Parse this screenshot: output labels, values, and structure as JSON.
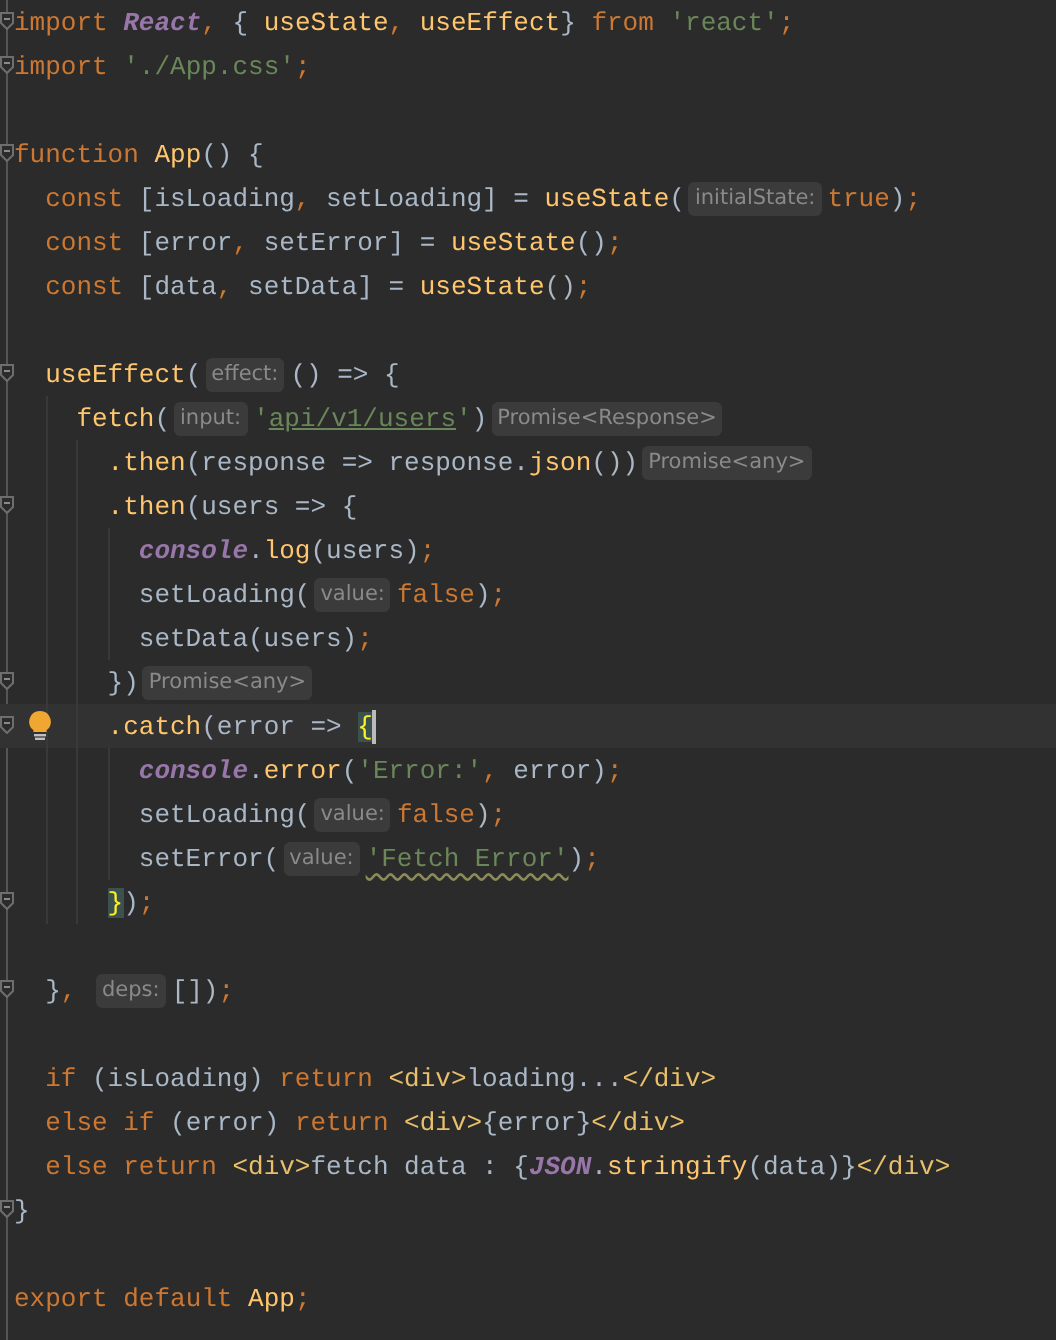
{
  "editor": {
    "lines": [
      {
        "fold": true,
        "current": false,
        "caret": false,
        "bulb": false,
        "tokens": [
          {
            "kind": "keyword",
            "text": "import "
          },
          {
            "kind": "global",
            "text": "React"
          },
          {
            "kind": "punct",
            "text": ", "
          },
          {
            "kind": "plain",
            "text": "{ "
          },
          {
            "kind": "function",
            "text": "useState"
          },
          {
            "kind": "punct",
            "text": ", "
          },
          {
            "kind": "function",
            "text": "useEffect"
          },
          {
            "kind": "plain",
            "text": "} "
          },
          {
            "kind": "keyword",
            "text": "from "
          },
          {
            "kind": "string",
            "text": "'react'"
          },
          {
            "kind": "punct",
            "text": ";"
          }
        ]
      },
      {
        "fold": true,
        "current": false,
        "caret": false,
        "bulb": false,
        "tokens": [
          {
            "kind": "keyword",
            "text": "import "
          },
          {
            "kind": "string",
            "text": "'./App.css'"
          },
          {
            "kind": "punct",
            "text": ";"
          }
        ]
      },
      {
        "fold": false,
        "current": false,
        "caret": false,
        "bulb": false
      },
      {
        "fold": true,
        "current": false,
        "caret": false,
        "bulb": false,
        "tokens": [
          {
            "kind": "keyword",
            "text": "function "
          },
          {
            "kind": "function",
            "text": "App"
          },
          {
            "kind": "plain",
            "text": "() {"
          }
        ]
      },
      {
        "fold": false,
        "current": false,
        "caret": false,
        "bulb": false,
        "tokens": [
          {
            "kind": "keyword",
            "text": "  const "
          },
          {
            "kind": "plain",
            "text": "[isLoading"
          },
          {
            "kind": "punct",
            "text": ", "
          },
          {
            "kind": "plain",
            "text": "setLoading] = "
          },
          {
            "kind": "function",
            "text": "useState"
          },
          {
            "kind": "plain",
            "text": "("
          },
          {
            "kind": "hint",
            "text": "initialState:"
          },
          {
            "kind": "keyword",
            "text": "true"
          },
          {
            "kind": "plain",
            "text": ")"
          },
          {
            "kind": "punct",
            "text": ";"
          }
        ]
      },
      {
        "fold": false,
        "current": false,
        "caret": false,
        "bulb": false,
        "tokens": [
          {
            "kind": "keyword",
            "text": "  const "
          },
          {
            "kind": "plain",
            "text": "[error"
          },
          {
            "kind": "punct",
            "text": ", "
          },
          {
            "kind": "plain",
            "text": "setError] = "
          },
          {
            "kind": "function",
            "text": "useState"
          },
          {
            "kind": "plain",
            "text": "()"
          },
          {
            "kind": "punct",
            "text": ";"
          }
        ]
      },
      {
        "fold": false,
        "current": false,
        "caret": false,
        "bulb": false,
        "tokens": [
          {
            "kind": "keyword",
            "text": "  const "
          },
          {
            "kind": "plain",
            "text": "[data"
          },
          {
            "kind": "punct",
            "text": ", "
          },
          {
            "kind": "plain",
            "text": "setData] = "
          },
          {
            "kind": "function",
            "text": "useState"
          },
          {
            "kind": "plain",
            "text": "()"
          },
          {
            "kind": "punct",
            "text": ";"
          }
        ]
      },
      {
        "fold": false,
        "current": false,
        "caret": false,
        "bulb": false
      },
      {
        "fold": true,
        "current": false,
        "caret": false,
        "bulb": false,
        "tokens": [
          {
            "kind": "function",
            "text": "  useEffect"
          },
          {
            "kind": "plain",
            "text": "("
          },
          {
            "kind": "hint",
            "text": "effect:"
          },
          {
            "kind": "plain",
            "text": "() => {"
          }
        ]
      },
      {
        "fold": false,
        "current": false,
        "caret": false,
        "bulb": false,
        "tokens": [
          {
            "kind": "function",
            "text": "    fetch"
          },
          {
            "kind": "plain",
            "text": "("
          },
          {
            "kind": "hint",
            "text": "input:"
          },
          {
            "kind": "string",
            "text": "'"
          },
          {
            "kind": "link",
            "text": "api/v1/users"
          },
          {
            "kind": "string",
            "text": "'"
          },
          {
            "kind": "plain",
            "text": ")"
          },
          {
            "kind": "hint",
            "text": "Promise<Response>"
          }
        ]
      },
      {
        "fold": false,
        "current": false,
        "caret": false,
        "bulb": false,
        "tokens": [
          {
            "kind": "function",
            "text": "      .then"
          },
          {
            "kind": "plain",
            "text": "(response => response."
          },
          {
            "kind": "function",
            "text": "json"
          },
          {
            "kind": "plain",
            "text": "())"
          },
          {
            "kind": "hint",
            "text": "Promise<any>"
          }
        ]
      },
      {
        "fold": true,
        "current": false,
        "caret": false,
        "bulb": false,
        "tokens": [
          {
            "kind": "function",
            "text": "      .then"
          },
          {
            "kind": "plain",
            "text": "(users => {"
          }
        ]
      },
      {
        "fold": false,
        "current": false,
        "caret": false,
        "bulb": false,
        "tokens": [
          {
            "kind": "global",
            "text": "        console"
          },
          {
            "kind": "plain",
            "text": "."
          },
          {
            "kind": "function",
            "text": "log"
          },
          {
            "kind": "plain",
            "text": "(users)"
          },
          {
            "kind": "punct",
            "text": ";"
          }
        ]
      },
      {
        "fold": false,
        "current": false,
        "caret": false,
        "bulb": false,
        "tokens": [
          {
            "kind": "plain",
            "text": "        setLoading("
          },
          {
            "kind": "hint",
            "text": "value:"
          },
          {
            "kind": "keyword",
            "text": "false"
          },
          {
            "kind": "plain",
            "text": ")"
          },
          {
            "kind": "punct",
            "text": ";"
          }
        ]
      },
      {
        "fold": false,
        "current": false,
        "caret": false,
        "bulb": false,
        "tokens": [
          {
            "kind": "plain",
            "text": "        setData(users)"
          },
          {
            "kind": "punct",
            "text": ";"
          }
        ]
      },
      {
        "fold": true,
        "current": false,
        "caret": false,
        "bulb": false,
        "tokens": [
          {
            "kind": "plain",
            "text": "      })"
          },
          {
            "kind": "hint",
            "text": "Promise<any>"
          }
        ]
      },
      {
        "fold": true,
        "current": true,
        "caret": true,
        "bulb": true,
        "tokens": [
          {
            "kind": "function",
            "text": "      .catch"
          },
          {
            "kind": "plain",
            "text": "(error => "
          },
          {
            "kind": "brace",
            "text": "{"
          }
        ]
      },
      {
        "fold": false,
        "current": false,
        "caret": false,
        "bulb": false,
        "tokens": [
          {
            "kind": "global",
            "text": "        console"
          },
          {
            "kind": "plain",
            "text": "."
          },
          {
            "kind": "function",
            "text": "error"
          },
          {
            "kind": "plain",
            "text": "("
          },
          {
            "kind": "string",
            "text": "'Error:'"
          },
          {
            "kind": "punct",
            "text": ", "
          },
          {
            "kind": "plain",
            "text": "error)"
          },
          {
            "kind": "punct",
            "text": ";"
          }
        ]
      },
      {
        "fold": false,
        "current": false,
        "caret": false,
        "bulb": false,
        "tokens": [
          {
            "kind": "plain",
            "text": "        setLoading("
          },
          {
            "kind": "hint",
            "text": "value:"
          },
          {
            "kind": "keyword",
            "text": "false"
          },
          {
            "kind": "plain",
            "text": ")"
          },
          {
            "kind": "punct",
            "text": ";"
          }
        ]
      },
      {
        "fold": false,
        "current": false,
        "caret": false,
        "bulb": false,
        "tokens": [
          {
            "kind": "plain",
            "text": "        setError("
          },
          {
            "kind": "hint",
            "text": "value:"
          },
          {
            "kind": "warning",
            "text": "'Fetch Error'"
          },
          {
            "kind": "plain",
            "text": ")"
          },
          {
            "kind": "punct",
            "text": ";"
          }
        ]
      },
      {
        "fold": true,
        "current": false,
        "caret": false,
        "bulb": false,
        "tokens": [
          {
            "kind": "brace",
            "text": "      }"
          },
          {
            "kind": "plain",
            "text": ")"
          },
          {
            "kind": "punct",
            "text": ";"
          }
        ]
      },
      {
        "fold": false,
        "current": false,
        "caret": false,
        "bulb": false
      },
      {
        "fold": true,
        "current": false,
        "caret": false,
        "bulb": false,
        "tokens": [
          {
            "kind": "plain",
            "text": "  }"
          },
          {
            "kind": "punct",
            "text": ", "
          },
          {
            "kind": "hint",
            "text": "deps:"
          },
          {
            "kind": "plain",
            "text": "[])"
          },
          {
            "kind": "punct",
            "text": ";"
          }
        ]
      },
      {
        "fold": false,
        "current": false,
        "caret": false,
        "bulb": false
      },
      {
        "fold": false,
        "current": false,
        "caret": false,
        "bulb": false,
        "tokens": [
          {
            "kind": "keyword",
            "text": "  if "
          },
          {
            "kind": "plain",
            "text": "(isLoading) "
          },
          {
            "kind": "keyword",
            "text": "return "
          },
          {
            "kind": "tag",
            "text": "<div>"
          },
          {
            "kind": "plain",
            "text": "loading..."
          },
          {
            "kind": "tag",
            "text": "</div>"
          }
        ]
      },
      {
        "fold": false,
        "current": false,
        "caret": false,
        "bulb": false,
        "tokens": [
          {
            "kind": "keyword",
            "text": "  else if "
          },
          {
            "kind": "plain",
            "text": "(error) "
          },
          {
            "kind": "keyword",
            "text": "return "
          },
          {
            "kind": "tag",
            "text": "<div>"
          },
          {
            "kind": "plain",
            "text": "{error}"
          },
          {
            "kind": "tag",
            "text": "</div>"
          }
        ]
      },
      {
        "fold": false,
        "current": false,
        "caret": false,
        "bulb": false,
        "tokens": [
          {
            "kind": "keyword",
            "text": "  else return "
          },
          {
            "kind": "tag",
            "text": "<div>"
          },
          {
            "kind": "plain",
            "text": "fetch data : {"
          },
          {
            "kind": "global",
            "text": "JSON"
          },
          {
            "kind": "plain",
            "text": "."
          },
          {
            "kind": "function",
            "text": "stringify"
          },
          {
            "kind": "plain",
            "text": "(data)}"
          },
          {
            "kind": "tag",
            "text": "</div>"
          }
        ]
      },
      {
        "fold": true,
        "current": false,
        "caret": false,
        "bulb": false,
        "tokens": [
          {
            "kind": "plain",
            "text": "}"
          }
        ]
      },
      {
        "fold": false,
        "current": false,
        "caret": false,
        "bulb": false
      },
      {
        "fold": false,
        "current": false,
        "caret": false,
        "bulb": false,
        "tokens": [
          {
            "kind": "keyword",
            "text": "export default "
          },
          {
            "kind": "function",
            "text": "App"
          },
          {
            "kind": "punct",
            "text": ";"
          }
        ]
      }
    ]
  }
}
